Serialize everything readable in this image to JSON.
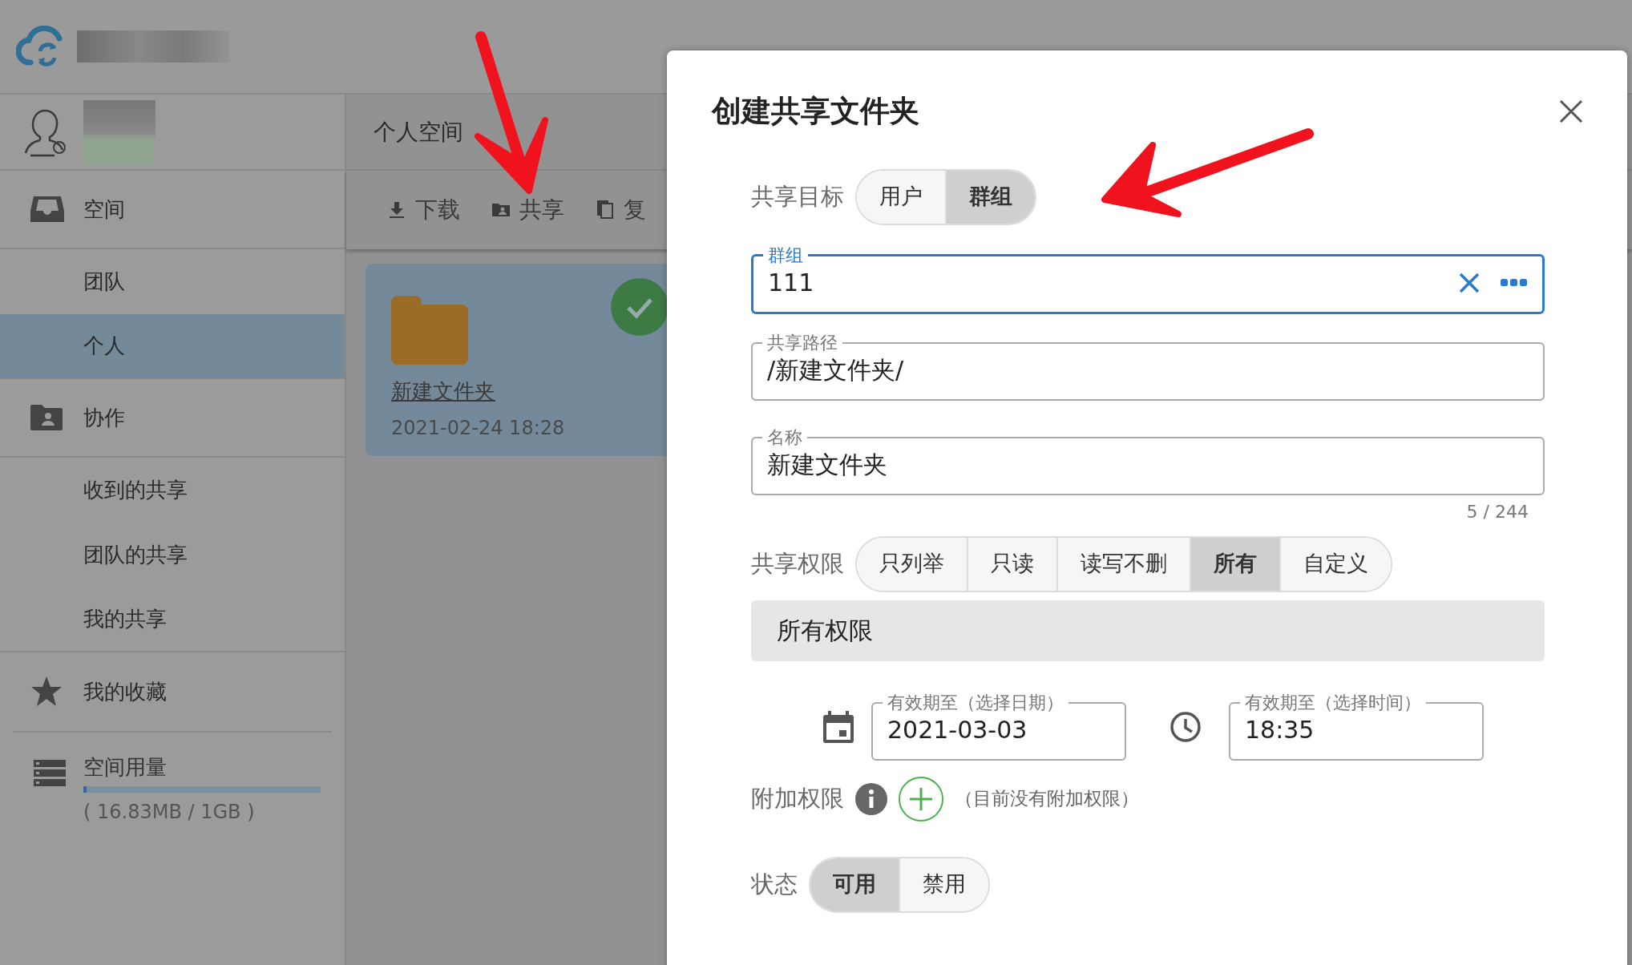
{
  "sidebar": {
    "items": [
      {
        "kind": "section",
        "label": "空间",
        "selected": false
      },
      {
        "kind": "sub",
        "label": "团队",
        "selected": false
      },
      {
        "kind": "sub",
        "label": "个人",
        "selected": true
      },
      {
        "kind": "section",
        "label": "协作",
        "selected": false
      },
      {
        "kind": "sub",
        "label": "收到的共享",
        "selected": false
      },
      {
        "kind": "sub",
        "label": "团队的共享",
        "selected": false
      },
      {
        "kind": "sub",
        "label": "我的共享",
        "selected": false
      },
      {
        "kind": "section",
        "label": "我的收藏",
        "selected": false
      }
    ],
    "usage": {
      "label": "空间用量",
      "level": 0.012,
      "reading": "( 16.83MB / 1GB )"
    }
  },
  "main": {
    "title": "个人空间",
    "toolbar": [
      {
        "label": "下载"
      },
      {
        "label": "共享"
      },
      {
        "label": "复"
      }
    ],
    "files": [
      {
        "name": "新建文件夹",
        "date": "2021-02-24 18:28",
        "selected": true
      }
    ]
  },
  "dialog": {
    "title": "创建共享文件夹",
    "target": {
      "label": "共享目标",
      "options": [
        {
          "label": "用户",
          "selected": false
        },
        {
          "label": "群组",
          "selected": true
        }
      ]
    },
    "fields": [
      {
        "label": "群组",
        "value": "111",
        "focused": true,
        "kind": "picker"
      },
      {
        "label": "共享路径",
        "value": "/新建文件夹/",
        "focused": false,
        "kind": "text"
      },
      {
        "label": "名称",
        "value": "新建文件夹",
        "focused": false,
        "kind": "text",
        "counter": "5 / 244"
      }
    ],
    "permissions": {
      "label": "共享权限",
      "options": [
        {
          "label": "只列举",
          "selected": false
        },
        {
          "label": "只读",
          "selected": false
        },
        {
          "label": "读写不删",
          "selected": false
        },
        {
          "label": "所有",
          "selected": true
        },
        {
          "label": "自定义",
          "selected": false
        }
      ]
    },
    "permission_description": "所有权限",
    "expiry_date": {
      "label": "有效期至（选择日期）",
      "value": "2021-03-03"
    },
    "expiry_time": {
      "label": "有效期至（选择时间）",
      "value": "18:35"
    },
    "extra": {
      "label": "附加权限",
      "note": "（目前没有附加权限）"
    },
    "status": {
      "label": "状态",
      "options": [
        {
          "label": "可用",
          "selected": true
        },
        {
          "label": "禁用",
          "selected": false
        }
      ]
    }
  }
}
